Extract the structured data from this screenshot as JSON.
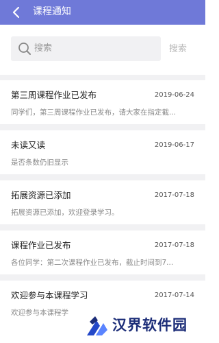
{
  "header": {
    "title": "课程通知",
    "back_icon": "chevron-left-icon"
  },
  "search": {
    "placeholder": "搜索",
    "submit_label": "搜索",
    "icon": "search-icon"
  },
  "notices": [
    {
      "title": "第三周课程作业已发布",
      "date": "2019-06-24",
      "preview": "同学们，第三周课程作业已发布，请大家在指定截..."
    },
    {
      "title": "未读又读",
      "date": "2019-06-17",
      "preview": "是否条数仍旧显示"
    },
    {
      "title": "拓展资源已添加",
      "date": "2017-07-18",
      "preview": "拓展资源已添加，欢迎登录学习。"
    },
    {
      "title": "课程作业已发布",
      "date": "2017-07-18",
      "preview": "各位同学：第二次课程作业已发布，截止时间到7..."
    },
    {
      "title": "欢迎参与本课程学习",
      "date": "2017-07-14",
      "preview": "欢迎参与本课程学"
    }
  ],
  "watermark": {
    "text": "汉界软件园",
    "logo": "watermark-logo-icon"
  },
  "colors": {
    "header_bg": "#6f79d8",
    "page_gap": "#f1f1f3",
    "watermark_text": "#1c2d78",
    "watermark_logo_primary": "#2448c8",
    "watermark_logo_secondary": "#5a84ff"
  }
}
